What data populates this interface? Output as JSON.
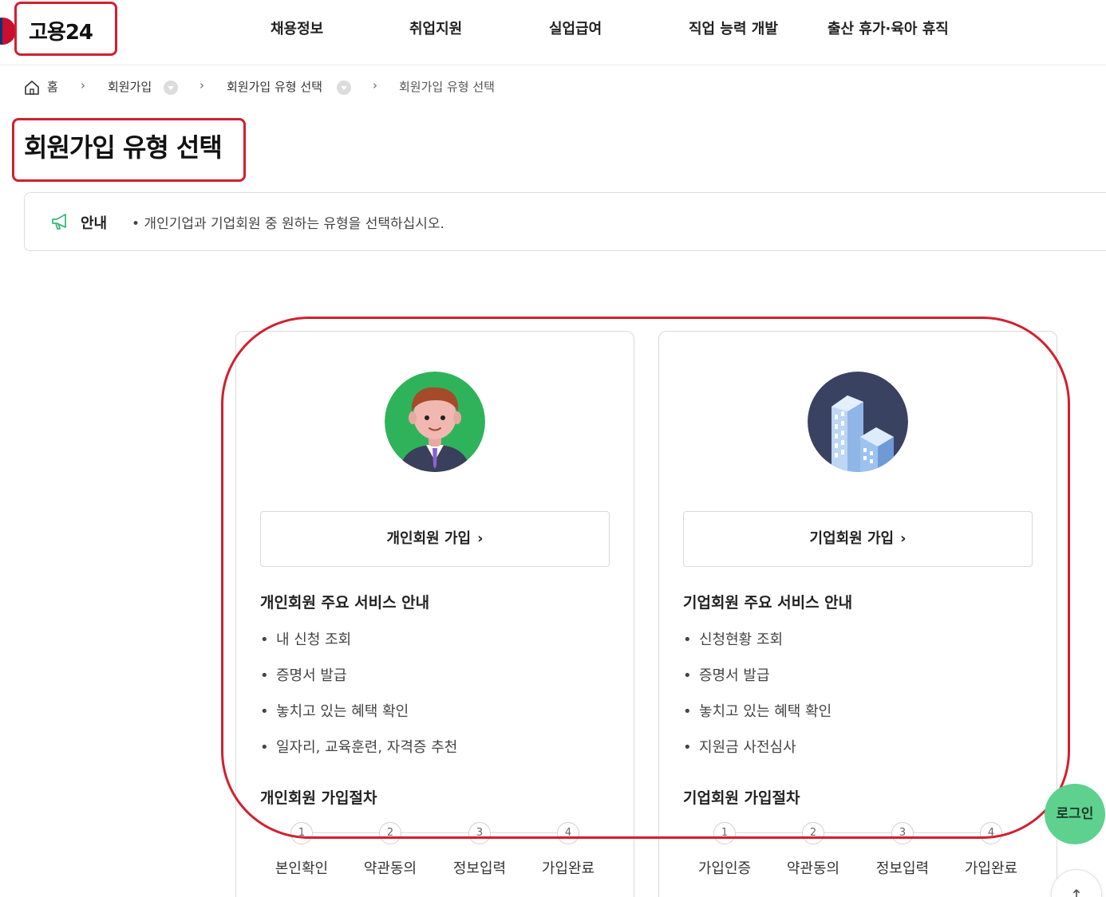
{
  "header": {
    "logo_text": "고용24",
    "nav": [
      "채용정보",
      "취업지원",
      "실업급여",
      "직업 능력 개발",
      "출산 휴가·육아 휴직"
    ]
  },
  "breadcrumb": {
    "home": "홈",
    "level1": "회원가입",
    "level2": "회원가입 유형 선택",
    "current": "회원가입 유형 선택"
  },
  "page_title": "회원가입 유형 선택",
  "notice": {
    "label": "안내",
    "text": "• 개인기업과 기업회원 중 원하는 유형을 선택하십시오."
  },
  "personal": {
    "button": "개인회원 가입",
    "service_title": "개인회원 주요 서비스 안내",
    "services": [
      "내 신청 조회",
      "증명서 발급",
      "놓치고 있는 혜택 확인",
      "일자리, 교육훈련, 자격증 추천"
    ],
    "process_title": "개인회원 가입절차",
    "steps": [
      {
        "num": "1",
        "label": "본인확인"
      },
      {
        "num": "2",
        "label": "약관동의"
      },
      {
        "num": "3",
        "label": "정보입력"
      },
      {
        "num": "4",
        "label": "가입완료"
      }
    ]
  },
  "company": {
    "button": "기업회원 가입",
    "service_title": "기업회원 주요 서비스 안내",
    "services": [
      "신청현황 조회",
      "증명서 발급",
      "놓치고 있는 혜택 확인",
      "지원금 사전심사"
    ],
    "process_title": "기업회원 가입절차",
    "steps": [
      {
        "num": "1",
        "label": "가입인증"
      },
      {
        "num": "2",
        "label": "약관동의"
      },
      {
        "num": "3",
        "label": "정보입력"
      },
      {
        "num": "4",
        "label": "가입완료"
      }
    ]
  },
  "floating": {
    "login": "로그인",
    "top_icon": "arrow-up-icon"
  },
  "colors": {
    "annotation_red": "#d1202f",
    "login_green": "#5fd18f",
    "personal_avatar_bg": "#2fb35a",
    "company_avatar_bg": "#3a4262"
  }
}
